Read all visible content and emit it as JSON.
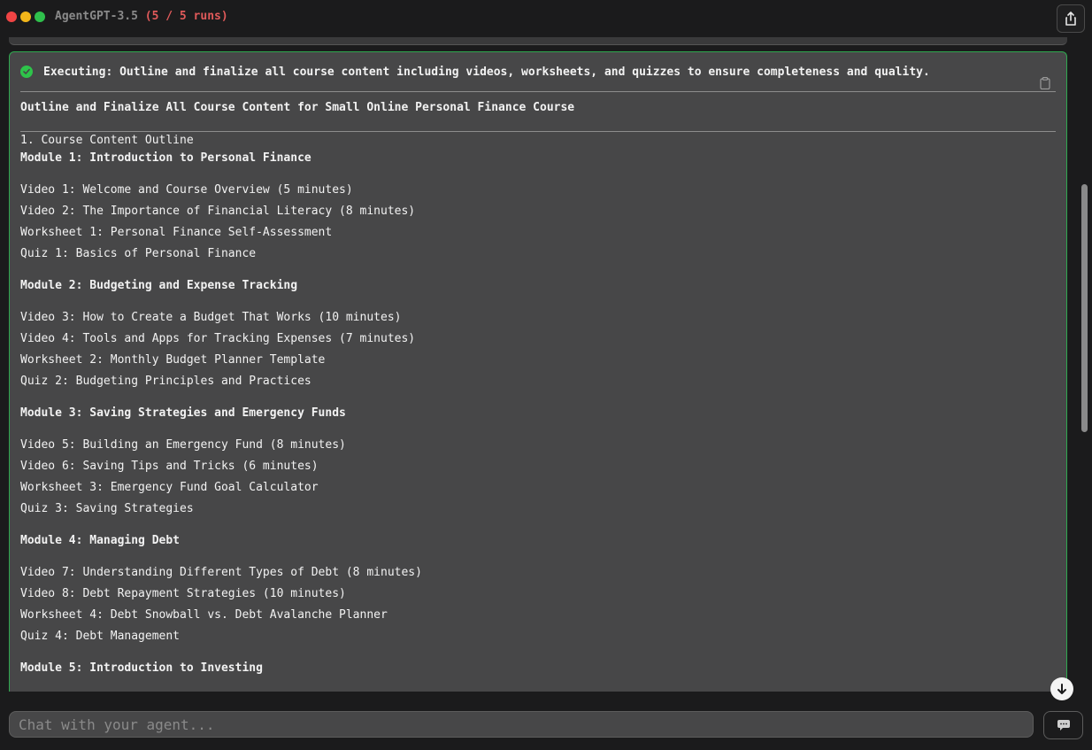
{
  "header": {
    "brand": "Agent",
    "model": "GPT-3.5",
    "runs": "(5 / 5 runs)",
    "dot_colors": [
      "#f04444",
      "#f2b61a",
      "#2fc04c"
    ]
  },
  "task": {
    "executing_label": "Executing: Outline and finalize all course content including videos, worksheets, and quizzes to ensure completeness and quality.",
    "heading": "Outline and Finalize All Course Content for Small Online Personal Finance Course",
    "section": "1. Course Content Outline",
    "modules": [
      {
        "title": "Module 1: Introduction to Personal Finance",
        "items": [
          "Video 1: Welcome and Course Overview (5 minutes)",
          "Video 2: The Importance of Financial Literacy (8 minutes)",
          "Worksheet 1: Personal Finance Self-Assessment",
          "Quiz 1: Basics of Personal Finance"
        ]
      },
      {
        "title": "Module 2: Budgeting and Expense Tracking",
        "items": [
          "Video 3: How to Create a Budget That Works (10 minutes)",
          "Video 4: Tools and Apps for Tracking Expenses (7 minutes)",
          "Worksheet 2: Monthly Budget Planner Template",
          "Quiz 2: Budgeting Principles and Practices"
        ]
      },
      {
        "title": "Module 3: Saving Strategies and Emergency Funds",
        "items": [
          "Video 5: Building an Emergency Fund (8 minutes)",
          "Video 6: Saving Tips and Tricks (6 minutes)",
          "Worksheet 3: Emergency Fund Goal Calculator",
          "Quiz 3: Saving Strategies"
        ]
      },
      {
        "title": "Module 4: Managing Debt",
        "items": [
          "Video 7: Understanding Different Types of Debt (8 minutes)",
          "Video 8: Debt Repayment Strategies (10 minutes)",
          "Worksheet 4: Debt Snowball vs. Debt Avalanche Planner",
          "Quiz 4: Debt Management"
        ]
      },
      {
        "title": "Module 5: Introduction to Investing",
        "items": []
      }
    ]
  },
  "chat": {
    "placeholder": "Chat with your agent..."
  },
  "icons": {
    "share": "share-icon",
    "check": "check-circle-icon",
    "copy": "clipboard-icon",
    "scroll_down": "arrow-down-circle-icon",
    "send": "chat-bubble-icon"
  },
  "colors": {
    "success": "#2ec44a",
    "runs_text": "#e05a5a",
    "card_border": "#2fa84f"
  }
}
